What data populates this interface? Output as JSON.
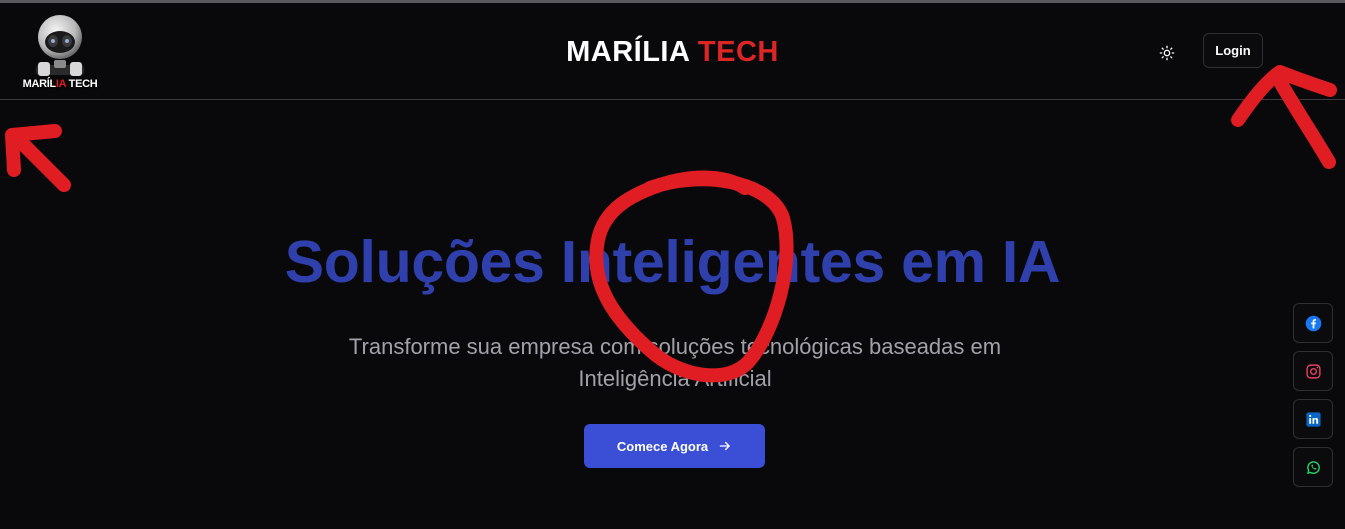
{
  "header": {
    "logo": {
      "caption_part1": "MARÍL",
      "caption_accent": "IA",
      "caption_part2": " TECH"
    },
    "brand": {
      "main": "MARÍLIA",
      "accent": "TECH"
    },
    "theme_toggle_icon": "sun-icon",
    "login_label": "Login"
  },
  "hero": {
    "title": "Soluções Inteligentes em IA",
    "subtitle": "Transforme sua empresa com soluções tecnológicas baseadas em Inteligência Artificial",
    "cta_label": "Comece Agora",
    "cta_icon": "arrow-right-icon"
  },
  "social": [
    {
      "name": "facebook",
      "icon": "facebook-icon",
      "color": "#1877f2"
    },
    {
      "name": "instagram",
      "icon": "instagram-icon",
      "color": "#e4405f"
    },
    {
      "name": "linkedin",
      "icon": "linkedin-icon",
      "color": "#0a66c2"
    },
    {
      "name": "whatsapp",
      "icon": "whatsapp-icon",
      "color": "#25d366"
    }
  ],
  "colors": {
    "background": "#09090b",
    "brand_accent": "#dc2626",
    "title": "#2f40ad",
    "cta": "#3b4fd6",
    "annotation": "#e11d24"
  }
}
